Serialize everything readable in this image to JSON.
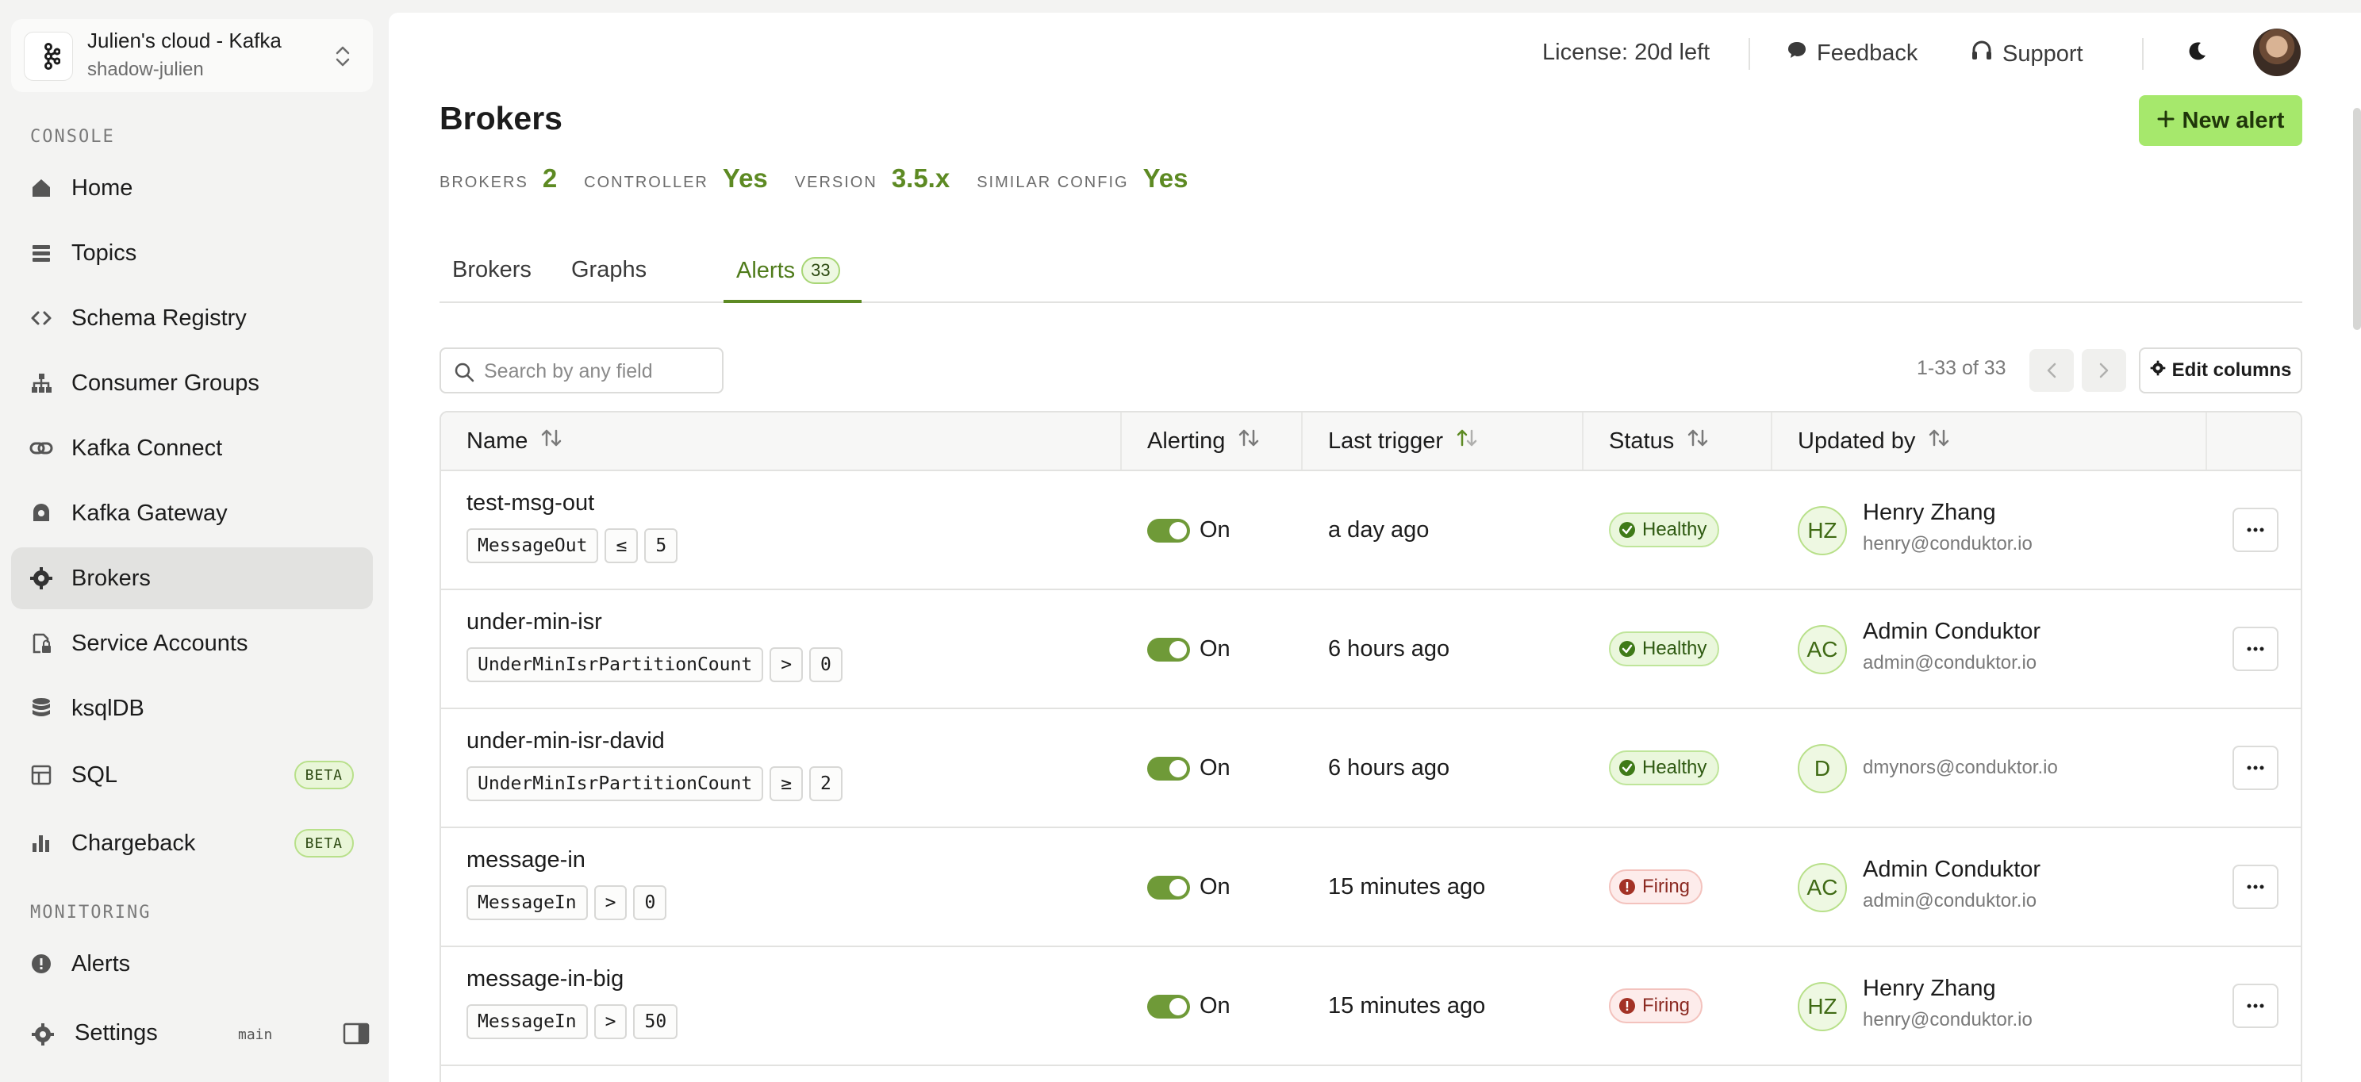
{
  "workspace": {
    "title": "Julien's cloud - Kafka",
    "subtitle": "shadow-julien"
  },
  "sidebar": {
    "console_label": "CONSOLE",
    "monitoring_label": "MONITORING",
    "items": [
      {
        "label": "Home",
        "icon": "home-icon"
      },
      {
        "label": "Topics",
        "icon": "topics-icon"
      },
      {
        "label": "Schema Registry",
        "icon": "code-icon"
      },
      {
        "label": "Consumer Groups",
        "icon": "hierarchy-icon"
      },
      {
        "label": "Kafka Connect",
        "icon": "link-icon"
      },
      {
        "label": "Kafka Gateway",
        "icon": "gateway-icon"
      },
      {
        "label": "Brokers",
        "icon": "cog-icon",
        "active": true
      },
      {
        "label": "Service Accounts",
        "icon": "file-lock-icon"
      },
      {
        "label": "ksqlDB",
        "icon": "database-icon"
      },
      {
        "label": "SQL",
        "icon": "table-icon",
        "badge": "BETA"
      },
      {
        "label": "Chargeback",
        "icon": "bar-chart-icon",
        "badge": "BETA"
      }
    ],
    "monitoring_items": [
      {
        "label": "Alerts",
        "icon": "alert-icon"
      }
    ],
    "settings_label": "Settings",
    "branch": "main"
  },
  "topbar": {
    "license": "License: 20d left",
    "feedback": "Feedback",
    "support": "Support"
  },
  "page": {
    "title": "Brokers",
    "new_alert_label": "New alert",
    "stats": [
      {
        "key": "BROKERS",
        "value": "2"
      },
      {
        "key": "CONTROLLER",
        "value": "Yes"
      },
      {
        "key": "VERSION",
        "value": "3.5.x"
      },
      {
        "key": "SIMILAR CONFIG",
        "value": "Yes"
      }
    ],
    "tabs": [
      {
        "label": "Brokers"
      },
      {
        "label": "Graphs"
      },
      {
        "label": "Alerts",
        "badge": "33",
        "active": true
      }
    ]
  },
  "table_controls": {
    "search_placeholder": "Search by any field",
    "pagination": "1-33 of 33",
    "edit_columns": "Edit columns"
  },
  "table": {
    "columns": [
      "Name",
      "Alerting",
      "Last trigger",
      "Status",
      "Updated by"
    ],
    "rows": [
      {
        "name": "test-msg-out",
        "metric": "MessageOut",
        "op": "≤",
        "threshold": "5",
        "alerting": "On",
        "last_trigger": "a day ago",
        "status": "Healthy",
        "initials": "HZ",
        "user_name": "Henry Zhang",
        "user_email": "henry@conduktor.io"
      },
      {
        "name": "under-min-isr",
        "metric": "UnderMinIsrPartitionCount",
        "op": ">",
        "threshold": "0",
        "alerting": "On",
        "last_trigger": "6 hours ago",
        "status": "Healthy",
        "initials": "AC",
        "user_name": "Admin Conduktor",
        "user_email": "admin@conduktor.io"
      },
      {
        "name": "under-min-isr-david",
        "metric": "UnderMinIsrPartitionCount",
        "op": "≥",
        "threshold": "2",
        "alerting": "On",
        "last_trigger": "6 hours ago",
        "status": "Healthy",
        "initials": "D",
        "user_name": "",
        "user_email": "dmynors@conduktor.io"
      },
      {
        "name": "message-in",
        "metric": "MessageIn",
        "op": ">",
        "threshold": "0",
        "alerting": "On",
        "last_trigger": "15 minutes ago",
        "status": "Firing",
        "initials": "AC",
        "user_name": "Admin Conduktor",
        "user_email": "admin@conduktor.io"
      },
      {
        "name": "message-in-big",
        "metric": "MessageIn",
        "op": ">",
        "threshold": "50",
        "alerting": "On",
        "last_trigger": "15 minutes ago",
        "status": "Firing",
        "initials": "HZ",
        "user_name": "Henry Zhang",
        "user_email": "henry@conduktor.io"
      }
    ]
  },
  "colors": {
    "accent": "#a6e86c",
    "healthy": "#2f5a12",
    "firing": "#8b2a22"
  }
}
